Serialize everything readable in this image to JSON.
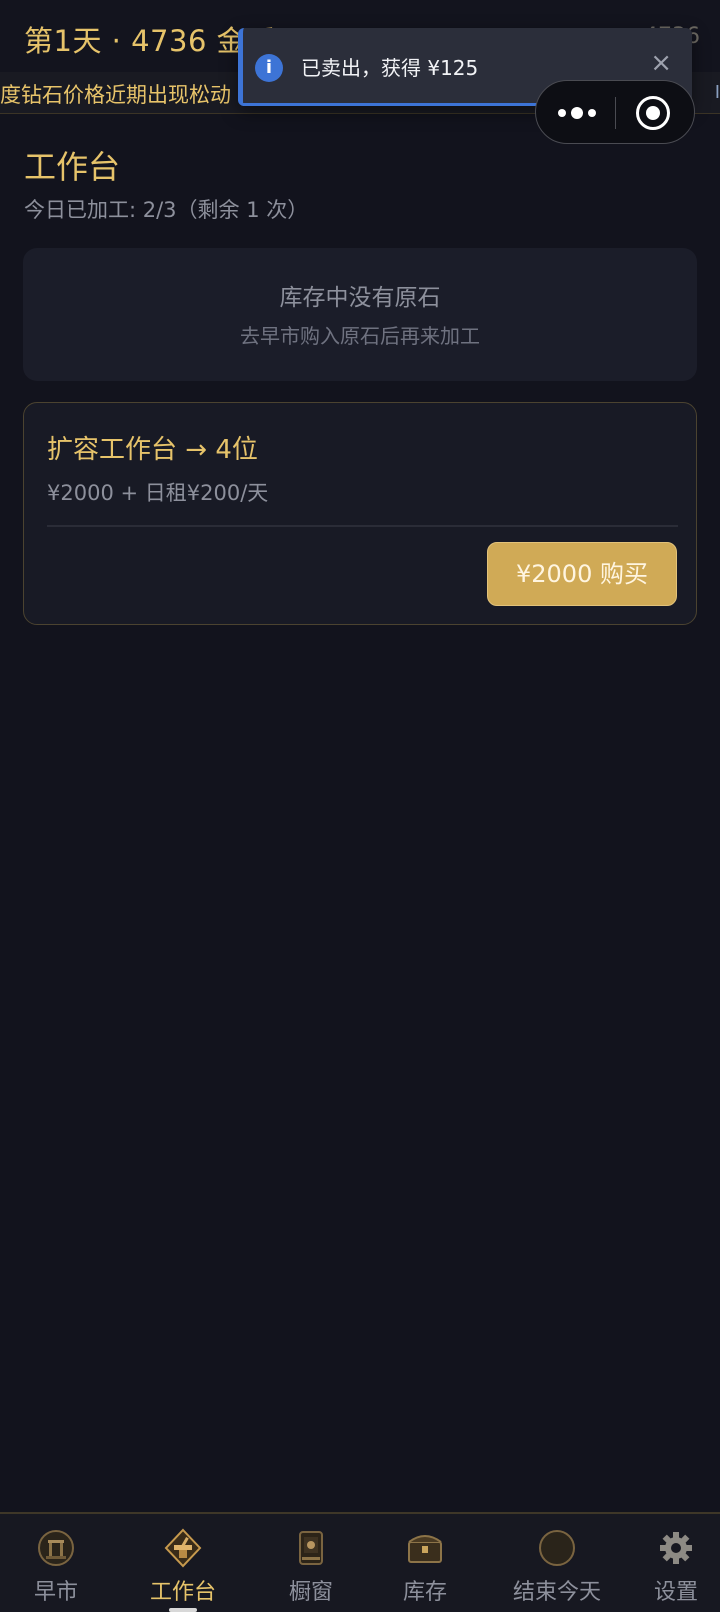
{
  "header": {
    "title": "第1天 · 4736 金币",
    "right_text": "4736"
  },
  "ticker": {
    "text": "度钻石价格近期出现松动",
    "end": "I"
  },
  "toast": {
    "icon": "i",
    "message": "已卖出，获得 ¥125",
    "close": "×"
  },
  "page": {
    "title": "工作台",
    "subtitle": "今日已加工: 2/3（剩余 1 次）"
  },
  "empty_state": {
    "title": "库存中没有原石",
    "subtitle": "去早市购入原石后再来加工"
  },
  "upgrade": {
    "title": "扩容工作台 → 4位",
    "description": "¥2000 + 日租¥200/天",
    "button_label": "¥2000 购买"
  },
  "nav": {
    "items": [
      {
        "label": "早市",
        "icon": "market-gate-icon"
      },
      {
        "label": "工作台",
        "icon": "anvil-icon"
      },
      {
        "label": "橱窗",
        "icon": "display-case-icon"
      },
      {
        "label": "库存",
        "icon": "treasure-chest-icon"
      },
      {
        "label": "结束今天",
        "icon": "moon-icon"
      },
      {
        "label": "设置",
        "icon": "gear-icon"
      }
    ]
  },
  "colors": {
    "background": "#12131d",
    "accent_gold": "#e6c36a",
    "toast_blue": "#3d74d6",
    "button_gold": "#d0aa56"
  }
}
